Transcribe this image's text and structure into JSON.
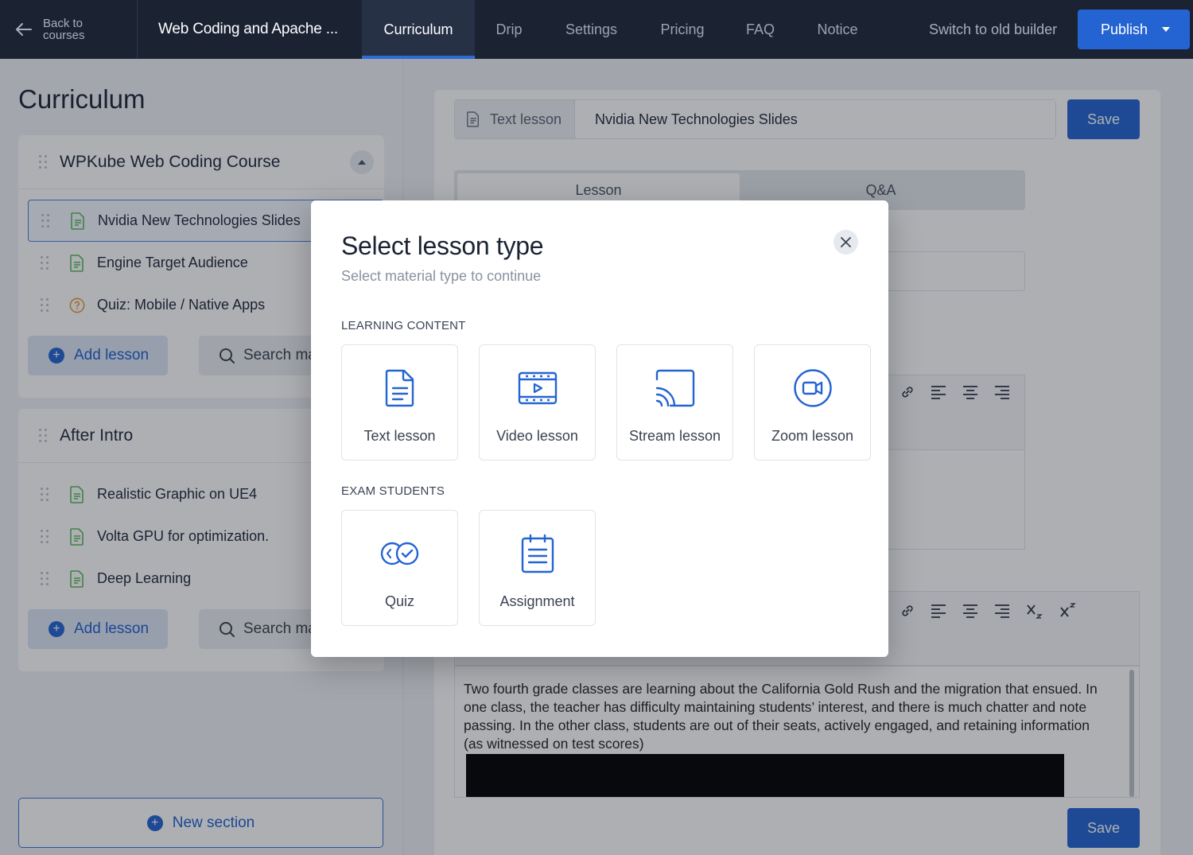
{
  "topbar": {
    "back_label_line1": "Back to",
    "back_label_line2": "courses",
    "course_title": "Web Coding and Apache ...",
    "tabs": [
      {
        "label": "Curriculum",
        "active": true
      },
      {
        "label": "Drip"
      },
      {
        "label": "Settings"
      },
      {
        "label": "Pricing"
      },
      {
        "label": "FAQ"
      },
      {
        "label": "Notice"
      }
    ],
    "switch_label": "Switch to old builder",
    "publish_label": "Publish"
  },
  "left": {
    "heading": "Curriculum",
    "sections": [
      {
        "title": "WPKube Web Coding Course",
        "lessons": [
          {
            "label": "Nvidia New Technologies Slides",
            "icon": "text-lesson-icon",
            "selected": true
          },
          {
            "label": "Engine Target Audience",
            "icon": "text-lesson-icon"
          },
          {
            "label": "Quiz: Mobile / Native Apps",
            "icon": "quiz-icon"
          }
        ],
        "add_label": "Add lesson",
        "search_label": "Search materials"
      },
      {
        "title": "After Intro",
        "lessons": [
          {
            "label": "Realistic Graphic on UE4",
            "icon": "text-lesson-icon"
          },
          {
            "label": "Volta GPU for optimization.",
            "icon": "text-lesson-icon"
          },
          {
            "label": "Deep Learning",
            "icon": "text-lesson-icon"
          }
        ],
        "add_label": "Add lesson",
        "search_label": "Search materials"
      }
    ],
    "new_section_label": "New section"
  },
  "editor": {
    "type_tag": "Text lesson",
    "title_value": "Nvidia New Technologies Slides",
    "save_label": "Save",
    "sub_tabs": [
      {
        "label": "Lesson",
        "active": true
      },
      {
        "label": "Q&A"
      }
    ],
    "content_text": "Two fourth grade classes are learning about the California Gold Rush and the migration that ensued. In one class, the teacher has difficulty maintaining students’ interest, and there is much chatter and note passing. In the other class, students are out of their seats, actively engaged, and retaining information (as witnessed on test scores)",
    "save_bottom_label": "Save"
  },
  "modal": {
    "title": "Select lesson type",
    "subtitle": "Select material type to continue",
    "groups": [
      {
        "title": "LEARNING CONTENT",
        "items": [
          {
            "label": "Text lesson",
            "icon": "text-lesson-icon"
          },
          {
            "label": "Video lesson",
            "icon": "video-lesson-icon"
          },
          {
            "label": "Stream lesson",
            "icon": "stream-lesson-icon"
          },
          {
            "label": "Zoom lesson",
            "icon": "zoom-lesson-icon"
          }
        ]
      },
      {
        "title": "EXAM STUDENTS",
        "items": [
          {
            "label": "Quiz",
            "icon": "quiz-icon"
          },
          {
            "label": "Assignment",
            "icon": "assignment-icon"
          }
        ]
      }
    ]
  },
  "colors": {
    "accent": "#2464d2",
    "topbar_bg": "#1b2333",
    "lesson_icon_green": "#5cb85c",
    "quiz_icon_orange": "#e6962a"
  }
}
